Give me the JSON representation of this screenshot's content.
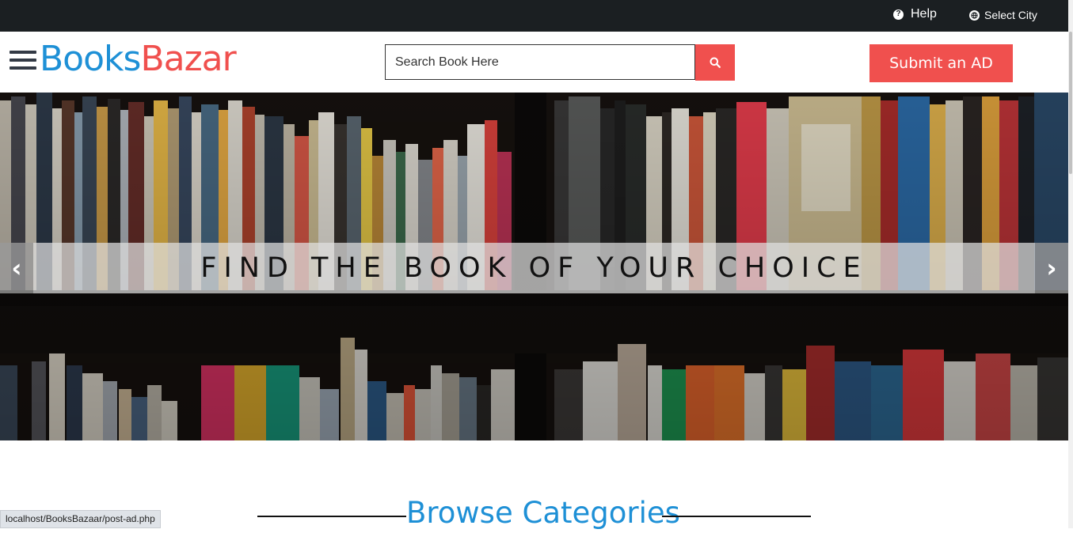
{
  "topbar": {
    "help_label": "Help",
    "city_label": "Select City"
  },
  "header": {
    "logo_part1": "Books",
    "logo_part2": "Bazar",
    "search": {
      "placeholder": "Search Book Here",
      "value": ""
    },
    "submit_label": "Submit an AD"
  },
  "hero": {
    "caption": "FIND THE BOOK OF YOUR CHOICE"
  },
  "browse": {
    "title": "Browse Categories"
  },
  "status_bar": {
    "url": "localhost/BooksBazaar/post-ad.php"
  },
  "colors": {
    "accent_red": "#f0504e",
    "brand_blue": "#1e90d6",
    "topbar_bg": "#1b1f22"
  }
}
